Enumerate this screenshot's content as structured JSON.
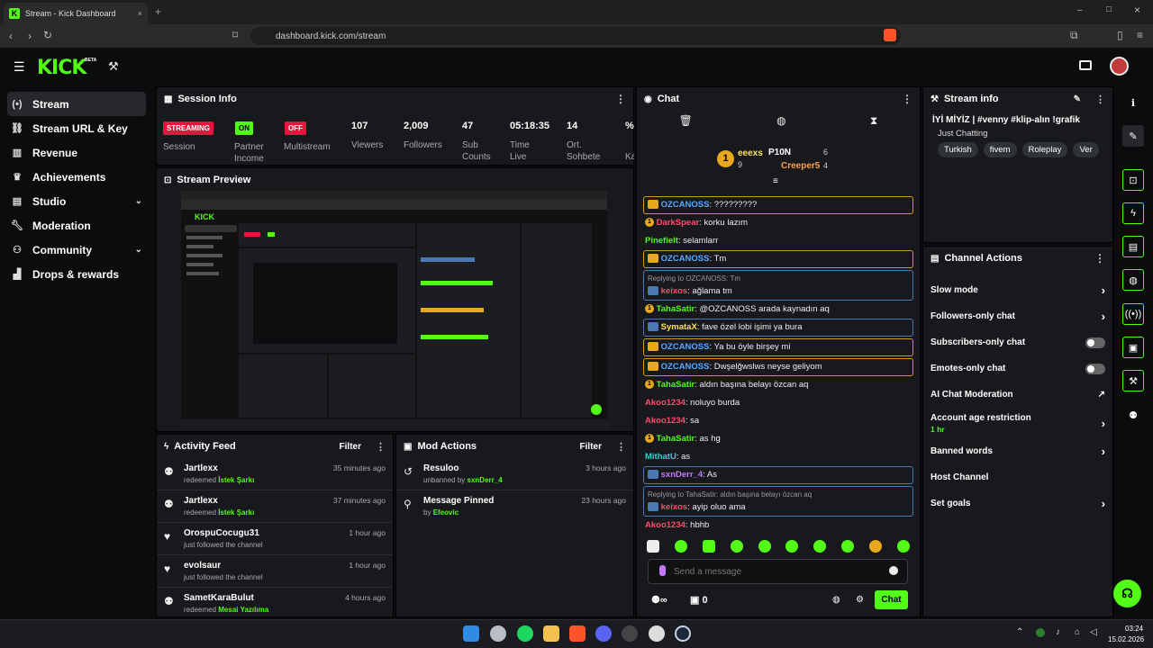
{
  "browser": {
    "tab_title": "Stream - Kick Dashboard",
    "url": "dashboard.kick.com/stream",
    "new_tab": "+",
    "window_controls": [
      "–",
      "□",
      "×"
    ]
  },
  "header": {
    "logo": "KICK",
    "beta": "BETA"
  },
  "sidebar": {
    "items": [
      {
        "label": "Stream",
        "icon": "broadcast-icon"
      },
      {
        "label": "Stream URL & Key",
        "icon": "link-icon"
      },
      {
        "label": "Revenue",
        "icon": "revenue-icon"
      },
      {
        "label": "Achievements",
        "icon": "trophy-icon"
      },
      {
        "label": "Studio",
        "icon": "studio-icon"
      },
      {
        "label": "Moderation",
        "icon": "wrench-icon"
      },
      {
        "label": "Community",
        "icon": "community-icon"
      },
      {
        "label": "Drops & rewards",
        "icon": "drops-icon"
      }
    ]
  },
  "session": {
    "title": "Session Info",
    "badges": [
      {
        "value": "STREAMING",
        "label": "Session",
        "color": "#e3173e"
      },
      {
        "value": "ON",
        "label": "Partner Income",
        "color": "#53fc18"
      },
      {
        "value": "OFF",
        "label": "Multistream",
        "color": "#e3173e"
      }
    ],
    "metrics": [
      {
        "value": "107",
        "label": "Viewers"
      },
      {
        "value": "2,009",
        "label": "Followers"
      },
      {
        "value": "47",
        "label": "Sub Counts"
      },
      {
        "value": "05:18:35",
        "label": "Time Live"
      },
      {
        "value": "14",
        "label": "Ort. Sohbete"
      },
      {
        "value": "%",
        "label": "Ka"
      }
    ]
  },
  "preview": {
    "title": "Stream Preview"
  },
  "activity": {
    "title": "Activity Feed",
    "filter": "Filter",
    "items": [
      {
        "name": "Jartlexx",
        "action": "redeemed",
        "highlight": "İstek Şarkı",
        "time": "35 minutes ago",
        "icon": "points-icon"
      },
      {
        "name": "Jartlexx",
        "action": "redeemed",
        "highlight": "İstek Şarkı",
        "time": "37 minutes ago",
        "icon": "points-icon"
      },
      {
        "name": "OrospuCocugu31",
        "action": "just followed the channel",
        "highlight": "",
        "time": "1 hour ago",
        "icon": "heart-icon"
      },
      {
        "name": "evolsaur",
        "action": "just followed the channel",
        "highlight": "",
        "time": "1 hour ago",
        "icon": "heart-icon"
      },
      {
        "name": "SametKaraBulut",
        "action": "redeemed",
        "highlight": "Mesai Yazılıma",
        "time": "4 hours ago",
        "icon": "points-icon"
      }
    ]
  },
  "mod": {
    "title": "Mod Actions",
    "filter": "Filter",
    "items": [
      {
        "name": "Resuloo",
        "action": "unbanned by",
        "by": "sxnDerr_4",
        "time": "3 hours ago"
      },
      {
        "name": "Message Pinned",
        "action": "by",
        "by": "Efeovic",
        "time": "23 hours ago"
      }
    ]
  },
  "chat": {
    "title": "Chat",
    "top": [
      {
        "rank": "1",
        "name": "eeexs",
        "count": "9"
      },
      {
        "name": "P10N",
        "count": "6"
      },
      {
        "name": "Creeper5",
        "count": "4"
      }
    ],
    "messages": [
      {
        "user": "OZCANOSS",
        "text": "?????????",
        "style": "gold"
      },
      {
        "user": "DarkSpear",
        "text": "korku lazım",
        "style": "plain",
        "color": "red"
      },
      {
        "user": "Pinefielt",
        "text": "selamlarr",
        "style": "plain",
        "color": "grn"
      },
      {
        "user": "OZCANOSS",
        "text": "Tm",
        "style": "gold"
      },
      {
        "user": "keixos",
        "text": "ağlama tm",
        "style": "blue",
        "reply": "Replying to OZCANOSS: Tm",
        "color": "red"
      },
      {
        "user": "TahaSatir",
        "text": "@OZCANOSS arada kaynadın aq",
        "style": "plain",
        "color": "grn"
      },
      {
        "user": "SymataX",
        "text": "fave özel lobi işimi ya bura",
        "style": "blue",
        "color": "yel"
      },
      {
        "user": "OZCANOSS",
        "text": "Ya bu öyle birşey mi",
        "style": "gold"
      },
      {
        "user": "OZCANOSS",
        "text": "Dwşelğwslws neyse geliyom",
        "style": "gold"
      },
      {
        "user": "TahaSatir",
        "text": "aldın başına belayı özcan aq",
        "style": "plain",
        "color": "grn"
      },
      {
        "user": "Akoo1234",
        "text": "noluyo burda",
        "style": "plain",
        "color": "red"
      },
      {
        "user": "Akoo1234",
        "text": "sa",
        "style": "plain",
        "color": "red"
      },
      {
        "user": "TahaSatir",
        "text": "as hg",
        "style": "plain",
        "color": "grn"
      },
      {
        "user": "MithatU",
        "text": "as",
        "style": "plain",
        "color": "cyan"
      },
      {
        "user": "sxnDerr_4",
        "text": "As",
        "style": "blue",
        "color": "purp"
      },
      {
        "user": "keixos",
        "text": "ayip oluo ama",
        "style": "blue",
        "reply": "Replying to TahaSatir: aldın başına belayı özcan aq",
        "color": "red"
      },
      {
        "user": "Akoo1234",
        "text": "hbhb",
        "style": "plain",
        "color": "red"
      }
    ],
    "input_placeholder": "Send a message",
    "send_label": "Chat",
    "footer_count": "0",
    "footer_infinity": "∞"
  },
  "stream_info": {
    "title": "Stream info",
    "stream_title": "İYİ MİYİZ | #venny #klip-alın !grafik",
    "category": "Just Chatting",
    "tags": [
      "Turkish",
      "fivem",
      "Roleplay",
      "Ver"
    ]
  },
  "channel_actions": {
    "title": "Channel Actions",
    "items": [
      {
        "label": "Slow mode",
        "control": "chevron"
      },
      {
        "label": "Followers-only chat",
        "control": "chevron"
      },
      {
        "label": "Subscribers-only chat",
        "control": "toggle"
      },
      {
        "label": "Emotes-only chat",
        "control": "toggle"
      },
      {
        "label": "AI Chat Moderation",
        "control": "external"
      },
      {
        "label": "Account age restriction",
        "sub": "1 hr",
        "control": "chevron"
      },
      {
        "label": "Banned words",
        "control": "chevron"
      },
      {
        "label": "Host Channel",
        "control": "none"
      },
      {
        "label": "Set goals",
        "control": "chevron"
      }
    ]
  },
  "taskbar": {
    "time": "03:24",
    "date": "15.02.2026"
  }
}
